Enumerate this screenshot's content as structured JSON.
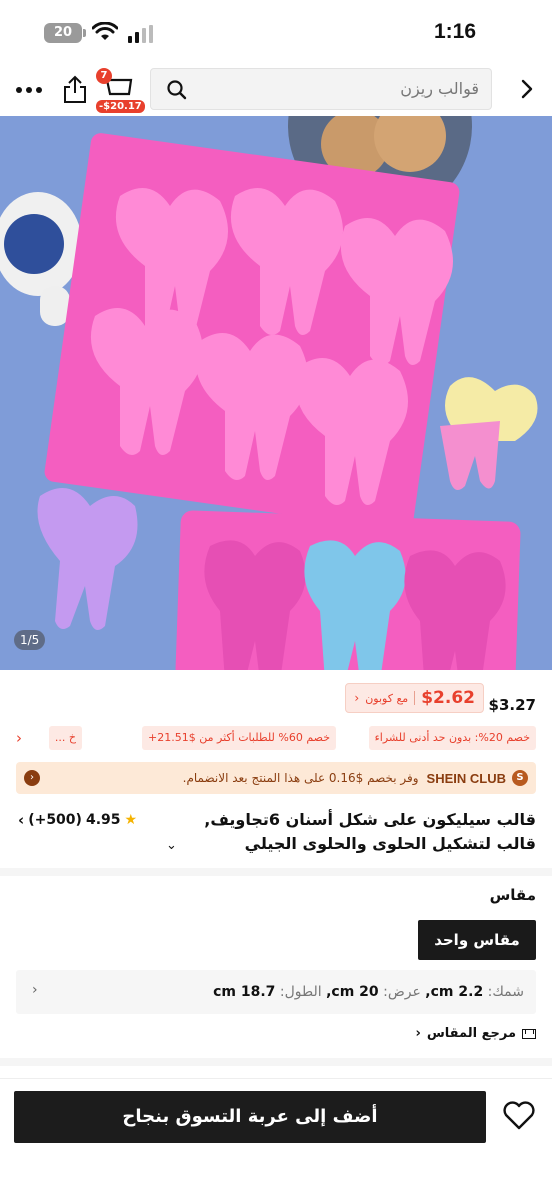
{
  "status_bar": {
    "battery": "20",
    "time": "1:16"
  },
  "header": {
    "cart_count": "7",
    "cart_price": "-$20.17",
    "search_text": "قوالب ريزن",
    "icons": [
      "more-icon",
      "share-icon",
      "cart-icon",
      "search-icon",
      "back-icon"
    ]
  },
  "gallery": {
    "counter": "1/5"
  },
  "price": {
    "original": "$3.27",
    "coupon_price": "$2.62",
    "coupon_label": "مع كوبون",
    "accent": "#e8402d"
  },
  "promos": [
    "خصم 20%: بدون حد أدنى للشراء",
    "خصم 60% للطلبات أكثر من $21.51+",
    "خ ..."
  ],
  "club": {
    "brand": "SHEIN CLUB",
    "text": "وفر بخصم $0.16 على هذا المنتج بعد الانضمام."
  },
  "product": {
    "title": "قالب سيليكون على شكل أسنان 6تجاويف, قالب لتشكيل الحلوى والحلوى الجيلي والبودينج والكو",
    "rating": "4.95",
    "reviews": "(+500)"
  },
  "size": {
    "label": "مقاس",
    "option": "مقاس واحد",
    "dims_thickness_label": "شمك:",
    "dims_thickness": "2.2 cm,",
    "dims_width_label": "عرض:",
    "dims_width": "20 cm,",
    "dims_length_label": "الطول:",
    "dims_length": "18.7 cm",
    "guide": "مرجع المقاس"
  },
  "bottom": {
    "add_to_cart": "أضف إلى عربة التسوق بنجاح"
  }
}
